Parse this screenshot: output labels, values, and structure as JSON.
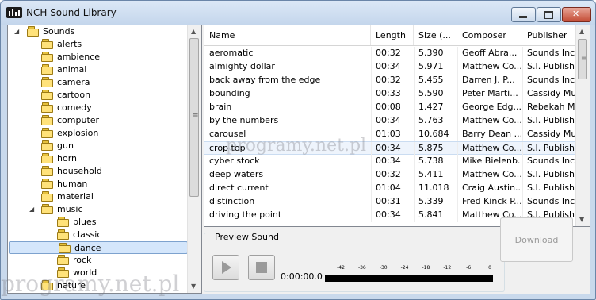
{
  "window": {
    "title": "NCH Sound Library",
    "controls": {
      "minimize": "▬",
      "maximize": "▢",
      "close": "✕"
    }
  },
  "tree": {
    "root": "Sounds",
    "items": [
      {
        "label": "alerts"
      },
      {
        "label": "ambience"
      },
      {
        "label": "animal"
      },
      {
        "label": "camera"
      },
      {
        "label": "cartoon"
      },
      {
        "label": "comedy"
      },
      {
        "label": "computer"
      },
      {
        "label": "explosion"
      },
      {
        "label": "gun"
      },
      {
        "label": "horn"
      },
      {
        "label": "household"
      },
      {
        "label": "human"
      },
      {
        "label": "material"
      },
      {
        "label": "music"
      },
      {
        "label": "blues"
      },
      {
        "label": "classic"
      },
      {
        "label": "dance"
      },
      {
        "label": "rock"
      },
      {
        "label": "world"
      },
      {
        "label": "nature"
      }
    ],
    "selected": "dance"
  },
  "list": {
    "columns": [
      "Name",
      "Length",
      "Size (...",
      "Composer",
      "Publisher"
    ],
    "rows": [
      [
        "aeromatic",
        "00:32",
        "5.390",
        "Geoff Abra...",
        "Sounds Incr..."
      ],
      [
        "almighty dollar",
        "00:34",
        "5.971",
        "Matthew Co...",
        "S.I. Publishi..."
      ],
      [
        "back away from the edge",
        "00:32",
        "5.455",
        "Darren J. P...",
        "Sounds Incr..."
      ],
      [
        "bounding",
        "00:33",
        "5.590",
        "Peter Marti...",
        "Cassidy Mu..."
      ],
      [
        "brain",
        "00:08",
        "1.427",
        "George Edg...",
        "Rebekah M..."
      ],
      [
        "by the numbers",
        "00:34",
        "5.763",
        "Matthew Co...",
        "S.I. Publishi..."
      ],
      [
        "carousel",
        "01:03",
        "10.684",
        "Barry Dean ...",
        "Cassidy Mu..."
      ],
      [
        "crop top",
        "00:34",
        "5.875",
        "Matthew Co...",
        "S.I. Publishi..."
      ],
      [
        "cyber stock",
        "00:34",
        "5.738",
        "Mike Bielenb...",
        "Sounds Incr..."
      ],
      [
        "deep waters",
        "00:32",
        "5.411",
        "Matthew Co...",
        "S.I. Publishi..."
      ],
      [
        "direct current",
        "01:04",
        "11.018",
        "Craig Austin...",
        "S.I. Publishi..."
      ],
      [
        "distinction",
        "00:31",
        "5.339",
        "Fred Kinck P...",
        "Sounds Incr..."
      ],
      [
        "driving the point",
        "00:34",
        "5.841",
        "Matthew Co...",
        "S.I. Publishi..."
      ]
    ],
    "hover_row": 7
  },
  "preview": {
    "label": "Preview Sound",
    "time": "0:00:00.0",
    "meter_scale": [
      "-42",
      "-36",
      "-30",
      "-24",
      "-18",
      "-12",
      "-6",
      "0"
    ],
    "download_label": "Download"
  },
  "watermarks": [
    "programy.net.pl",
    "programy.net.pl"
  ],
  "colors": {
    "selection": "#d4e6fb",
    "frame": "#c9d9ec"
  }
}
